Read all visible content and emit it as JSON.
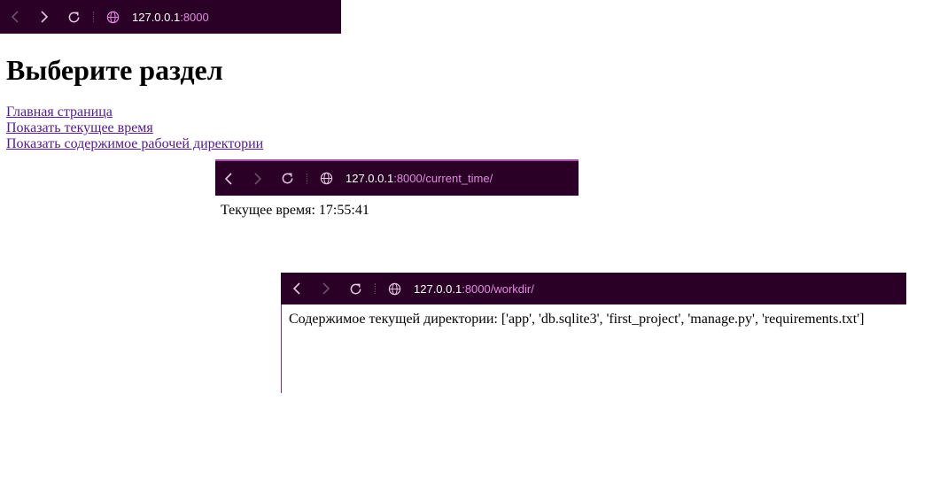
{
  "windows": [
    {
      "url_host": "127.0.0.1",
      "url_rest": ":8000",
      "icons": [
        "back-icon",
        "forward-icon",
        "reload-icon",
        "globe-icon"
      ]
    },
    {
      "url_host": "127.0.0.1",
      "url_rest": ":8000/current_time/",
      "icons": [
        "back-icon",
        "forward-icon",
        "reload-icon",
        "globe-icon"
      ]
    },
    {
      "url_host": "127.0.0.1",
      "url_rest": ":8000/workdir/",
      "icons": [
        "back-icon",
        "forward-icon",
        "reload-icon",
        "globe-icon"
      ]
    }
  ],
  "home": {
    "heading": "Выберите раздел",
    "links": [
      "Главная страница",
      "Показать текущее время",
      "Показать содержимое рабочей директории"
    ]
  },
  "current_time_page": {
    "text": "Текущее время: 17:55:41"
  },
  "workdir_page": {
    "text": "Содержимое текущей директории: ['app', 'db.sqlite3', 'first_project', 'manage.py', 'requirements.txt']"
  },
  "colors": {
    "toolbar_bg": "#2b0027",
    "url_host": "#ffffff",
    "url_path": "#e08be0",
    "link_visited": "#551a8b"
  }
}
